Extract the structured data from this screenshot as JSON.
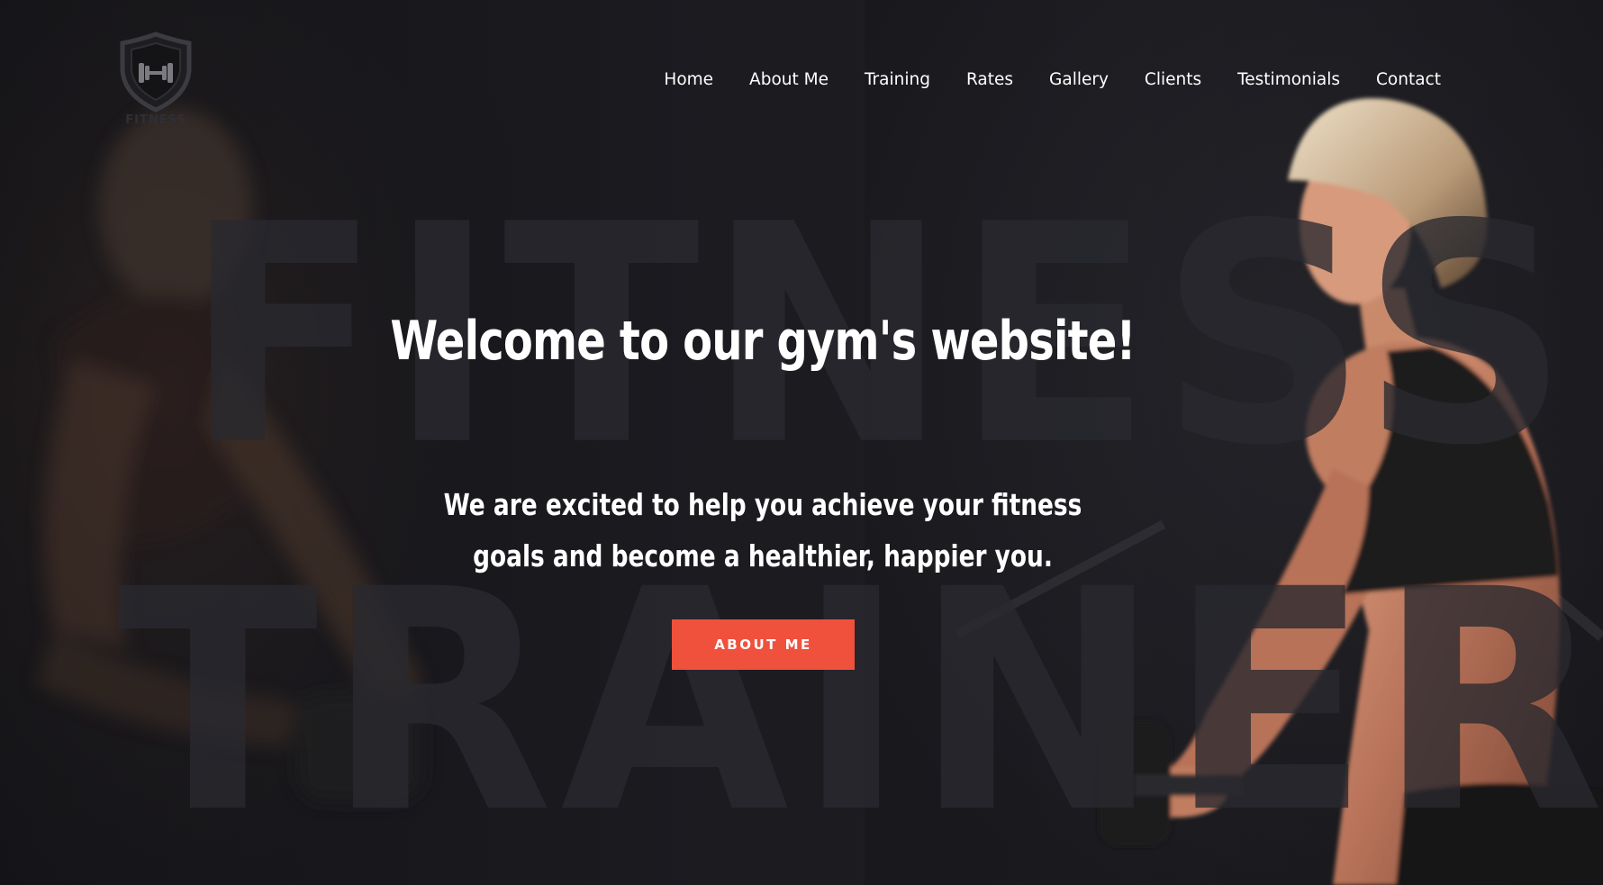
{
  "logo": {
    "icon": "dumbbell-shield-icon",
    "text": "FITNESS"
  },
  "nav": {
    "items": [
      {
        "label": "Home"
      },
      {
        "label": "About Me"
      },
      {
        "label": "Training"
      },
      {
        "label": "Rates"
      },
      {
        "label": "Gallery"
      },
      {
        "label": "Clients"
      },
      {
        "label": "Testimonials"
      },
      {
        "label": "Contact"
      }
    ]
  },
  "background": {
    "word_top": "FITNESS",
    "word_bottom": "TRAINER"
  },
  "hero": {
    "title": "Welcome to our gym's website!",
    "subtitle_line1": "We are excited to help you achieve your fitness",
    "subtitle_line2": "goals and become a healthier, happier you.",
    "cta_label": "ABOUT ME"
  },
  "colors": {
    "background": "#17171c",
    "accent": "#f0513d",
    "text": "#ffffff"
  }
}
